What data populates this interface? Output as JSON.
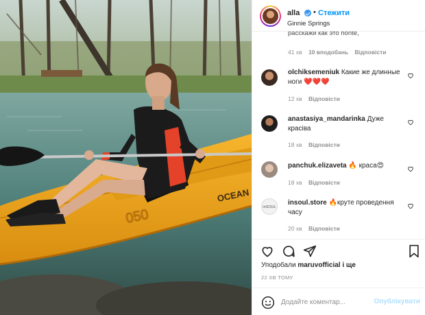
{
  "post": {
    "username": "alla",
    "follow_label": "Стежити",
    "separator": "•",
    "location": "Ginnie Springs",
    "more_icon": "ellipsis-icon"
  },
  "photo": {
    "kayak_text": "OCEAN",
    "kayak_number": "050",
    "icon": "kayak-photo"
  },
  "comments": {
    "previous_cut_text": "расскажи как это honte,",
    "previous_meta": {
      "time": "41 хв",
      "likes": "10 вподобань",
      "reply": "Відповісти"
    },
    "items": [
      {
        "username": "olchiksemeniuk",
        "text": "Какие же длинные ноги ❤️❤️❤️",
        "time": "12 хв",
        "reply": "Відповісти"
      },
      {
        "username": "anastasiya_mandarinka",
        "text": "Дуже красіва",
        "time": "18 хв",
        "reply": "Відповісти"
      },
      {
        "username": "panchuk.elizaveta",
        "text": "🔥 краса😍",
        "time": "18 хв",
        "reply": "Відповісти"
      },
      {
        "username": "insoul.store",
        "text": "🔥круте проведення часу",
        "time": "20 хв",
        "reply": "Відповісти",
        "avatar_text": "inSOUL"
      }
    ]
  },
  "actions": {
    "likes_prefix": "Уподобали",
    "likes_user": "maruvofficial",
    "likes_suffix": "і ще",
    "timestamp": "22 ХВ ТОМУ",
    "comment_placeholder": "Додайте коментар...",
    "post_label": "Опублікувати",
    "colors": {
      "accent": "#0095f6",
      "post_disabled": "#b2dffc",
      "heart": "#ed4956"
    }
  }
}
